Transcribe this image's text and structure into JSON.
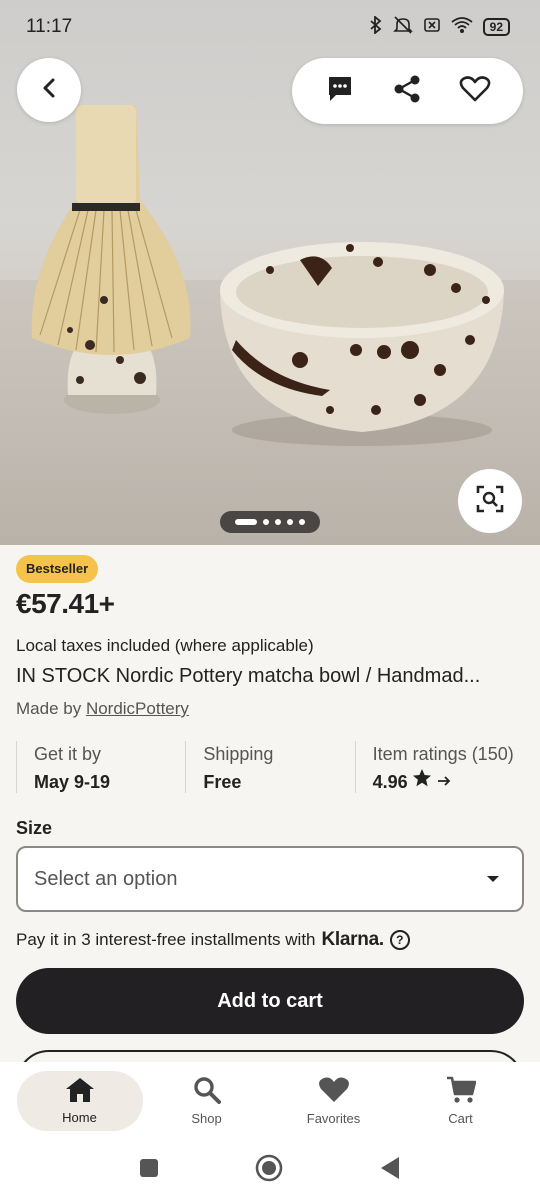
{
  "status_bar": {
    "time": "11:17",
    "battery": "92",
    "icons": [
      "bluetooth-icon",
      "mute-icon",
      "sim-off-icon",
      "wifi-icon",
      "battery-icon"
    ]
  },
  "gallery": {
    "image_count": 5,
    "active_index": 0,
    "actions": [
      "message-icon",
      "share-icon",
      "favorite-icon"
    ]
  },
  "product": {
    "badge": "Bestseller",
    "price": "€57.41+",
    "taxes_note": "Local taxes included (where applicable)",
    "title": "IN STOCK Nordic Pottery matcha bowl / Handmad...",
    "made_by_prefix": "Made by ",
    "shop_name": "NordicPottery"
  },
  "info": {
    "delivery_label": "Get it by",
    "delivery_value": "May 9-19",
    "shipping_label": "Shipping",
    "shipping_value": "Free",
    "ratings_label": "Item ratings (150)",
    "ratings_value": "4.96"
  },
  "options": {
    "size_label": "Size",
    "size_placeholder": "Select an option"
  },
  "klarna": {
    "text": "Pay it in 3 interest-free installments with",
    "brand": "Klarna."
  },
  "cta": {
    "add_to_cart": "Add to cart"
  },
  "bottom_nav": {
    "items": [
      {
        "label": "Home",
        "icon": "home-icon",
        "active": true
      },
      {
        "label": "Shop",
        "icon": "search-icon",
        "active": false
      },
      {
        "label": "Favorites",
        "icon": "heart-icon",
        "active": false
      },
      {
        "label": "Cart",
        "icon": "cart-icon",
        "active": false
      }
    ]
  },
  "colors": {
    "badge": "#f5c24c",
    "cta": "#222022",
    "background": "#f7f5f1"
  }
}
